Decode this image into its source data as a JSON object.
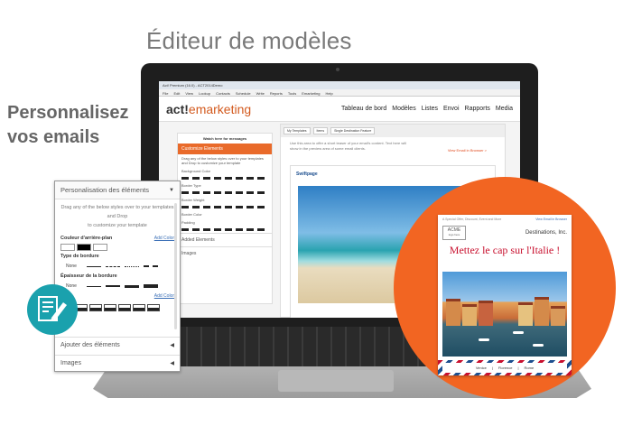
{
  "headline": "Éditeur de modèles",
  "tagline": {
    "line1": "Personnalisez",
    "line2": "vos emails"
  },
  "screen": {
    "window_title": "Act! Premium (16.0) - ACT2014Demo",
    "menu": [
      "File",
      "Edit",
      "View",
      "Lookup",
      "Contacts",
      "Schedule",
      "Write",
      "Reports",
      "Tools",
      "Emarketing",
      "Help"
    ],
    "logo_act": "act!",
    "logo_emarketing": "emarketing",
    "nav": [
      "Tableau de bord",
      "Modèles",
      "Listes",
      "Envoi",
      "Rapports",
      "Media"
    ],
    "sidebar_header": "Watch here for messages",
    "panel_title": "Customize Elements",
    "panel_desc": "Drag any of the below styles over to your templates and Drop to customize your template",
    "rows": [
      "Background Color",
      "Border Type",
      "Border Weight",
      "Border Color",
      "Padding"
    ],
    "add_color": "Add Color",
    "acc_added": "Added Elements",
    "acc_images": "Images",
    "crumbs": [
      "My Templates",
      "Items",
      "Single Destination Feature"
    ],
    "note": "Use this area to offer a short teaser of your email's content. Text here will show in the preview area of some email clients.",
    "view_link": "View Email in Browser >",
    "email_brand": "Swiftpage"
  },
  "panel": {
    "title": "Personalisation des éléments",
    "desc_line1": "Drag any of the below styles over to your templates and Drop",
    "desc_line2": "to customize your template",
    "bg_color_label": "Couleur d'arrière-plan",
    "add_color_1": "Add Color",
    "border_type_label": "Type de bordure",
    "none_1": "None",
    "border_weight_label": "Épaisseur de la bordure",
    "none_2": "None",
    "add_color_2": "Add Color",
    "acc_added": "Ajouter des éléments",
    "acc_images": "Images"
  },
  "card": {
    "top_left": "A Special Offer, Discount, Event and More",
    "top_right": "View Email in Browser",
    "logo": "ACME",
    "logo_sub": "logo here",
    "company": "Destinations, Inc.",
    "title": "Mettez le cap sur l'Italie !",
    "footer_links": [
      "Venice",
      "Florence",
      "Rome"
    ]
  },
  "colors": {
    "accent_orange": "#f26522",
    "teal_badge": "#1aa1ad",
    "italy_red": "#c8102e"
  },
  "icons": {
    "edit_badge": "edit-document-icon"
  }
}
